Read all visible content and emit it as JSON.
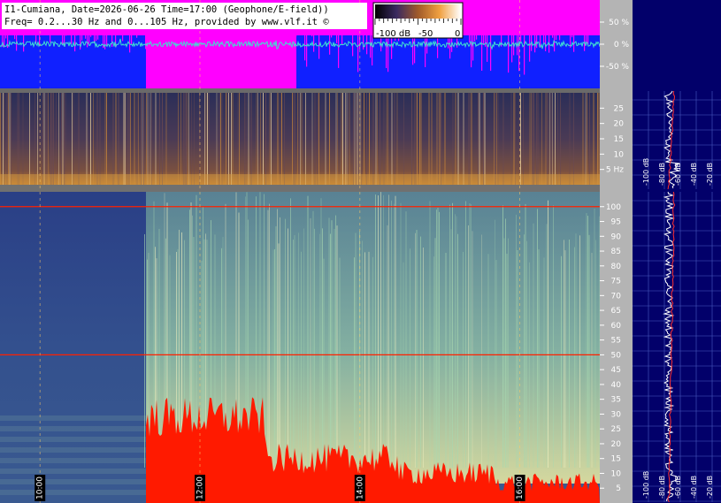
{
  "header": {
    "line1": "I1-Cumiana, Date=2026-06-26 Time=17:00 (Geophone/E-field))",
    "line2": "Freq= 0.2...30 Hz and 0...105 Hz, provided by www.vlf.it ©"
  },
  "colorbar": {
    "labels": [
      "-100 dB",
      "-50",
      "0"
    ]
  },
  "chart_data": [
    {
      "type": "area",
      "panel": "waveform",
      "y_unit": "%",
      "y_ticks": [
        "50 %",
        "0 %",
        "-50 %"
      ],
      "y_tick_values": [
        50,
        0,
        -50
      ],
      "ylim": [
        -100,
        100
      ],
      "series": [
        {
          "color": "#ff00ff"
        },
        {
          "color": "#1020ff"
        },
        {
          "color": "#40e0d0"
        }
      ]
    },
    {
      "type": "heatmap",
      "panel": "spectrogram-0.2-30Hz",
      "y_unit": "Hz",
      "y_ticks": [
        "25",
        "20",
        "15",
        "10",
        "5 Hz"
      ],
      "y_tick_values": [
        25,
        20,
        15,
        10,
        5
      ],
      "ylim": [
        0,
        30
      ]
    },
    {
      "type": "heatmap",
      "panel": "spectrogram-0-105Hz",
      "y_ticks": [
        "100",
        "95",
        "90",
        "85",
        "80",
        "75",
        "70",
        "65",
        "60",
        "55",
        "50",
        "45",
        "40",
        "35",
        "30",
        "25",
        "20",
        "15",
        "10",
        "5"
      ],
      "y_tick_values": [
        100,
        95,
        90,
        85,
        80,
        75,
        70,
        65,
        60,
        55,
        50,
        45,
        40,
        35,
        30,
        25,
        20,
        15,
        10,
        5
      ],
      "ylim": [
        0,
        105
      ],
      "x_time_labels": [
        "10:00",
        "12:00",
        "14:00",
        "16:00"
      ],
      "lines_hz": [
        100,
        50
      ],
      "x_range_hours": [
        9.5,
        17.0
      ]
    },
    {
      "type": "line",
      "panel": "side-spectrum-top",
      "x_tick_labels": [
        "-100 dB",
        "-80 dB",
        "-60 dB",
        "-40 dB",
        "-20 dB"
      ]
    },
    {
      "type": "line",
      "panel": "side-spectrum-bottom",
      "x_tick_labels": [
        "-100 dB",
        "-80 dB",
        "-60 dB",
        "-40 dB",
        "-20 dB"
      ]
    }
  ],
  "colors": {
    "magenta": "#ff00ff",
    "blue": "#1020ff",
    "cyan": "#40e0d0",
    "red_fill": "#ff1a00",
    "side_bg": "#02006a",
    "axis_bg": "#b4b4b4"
  }
}
